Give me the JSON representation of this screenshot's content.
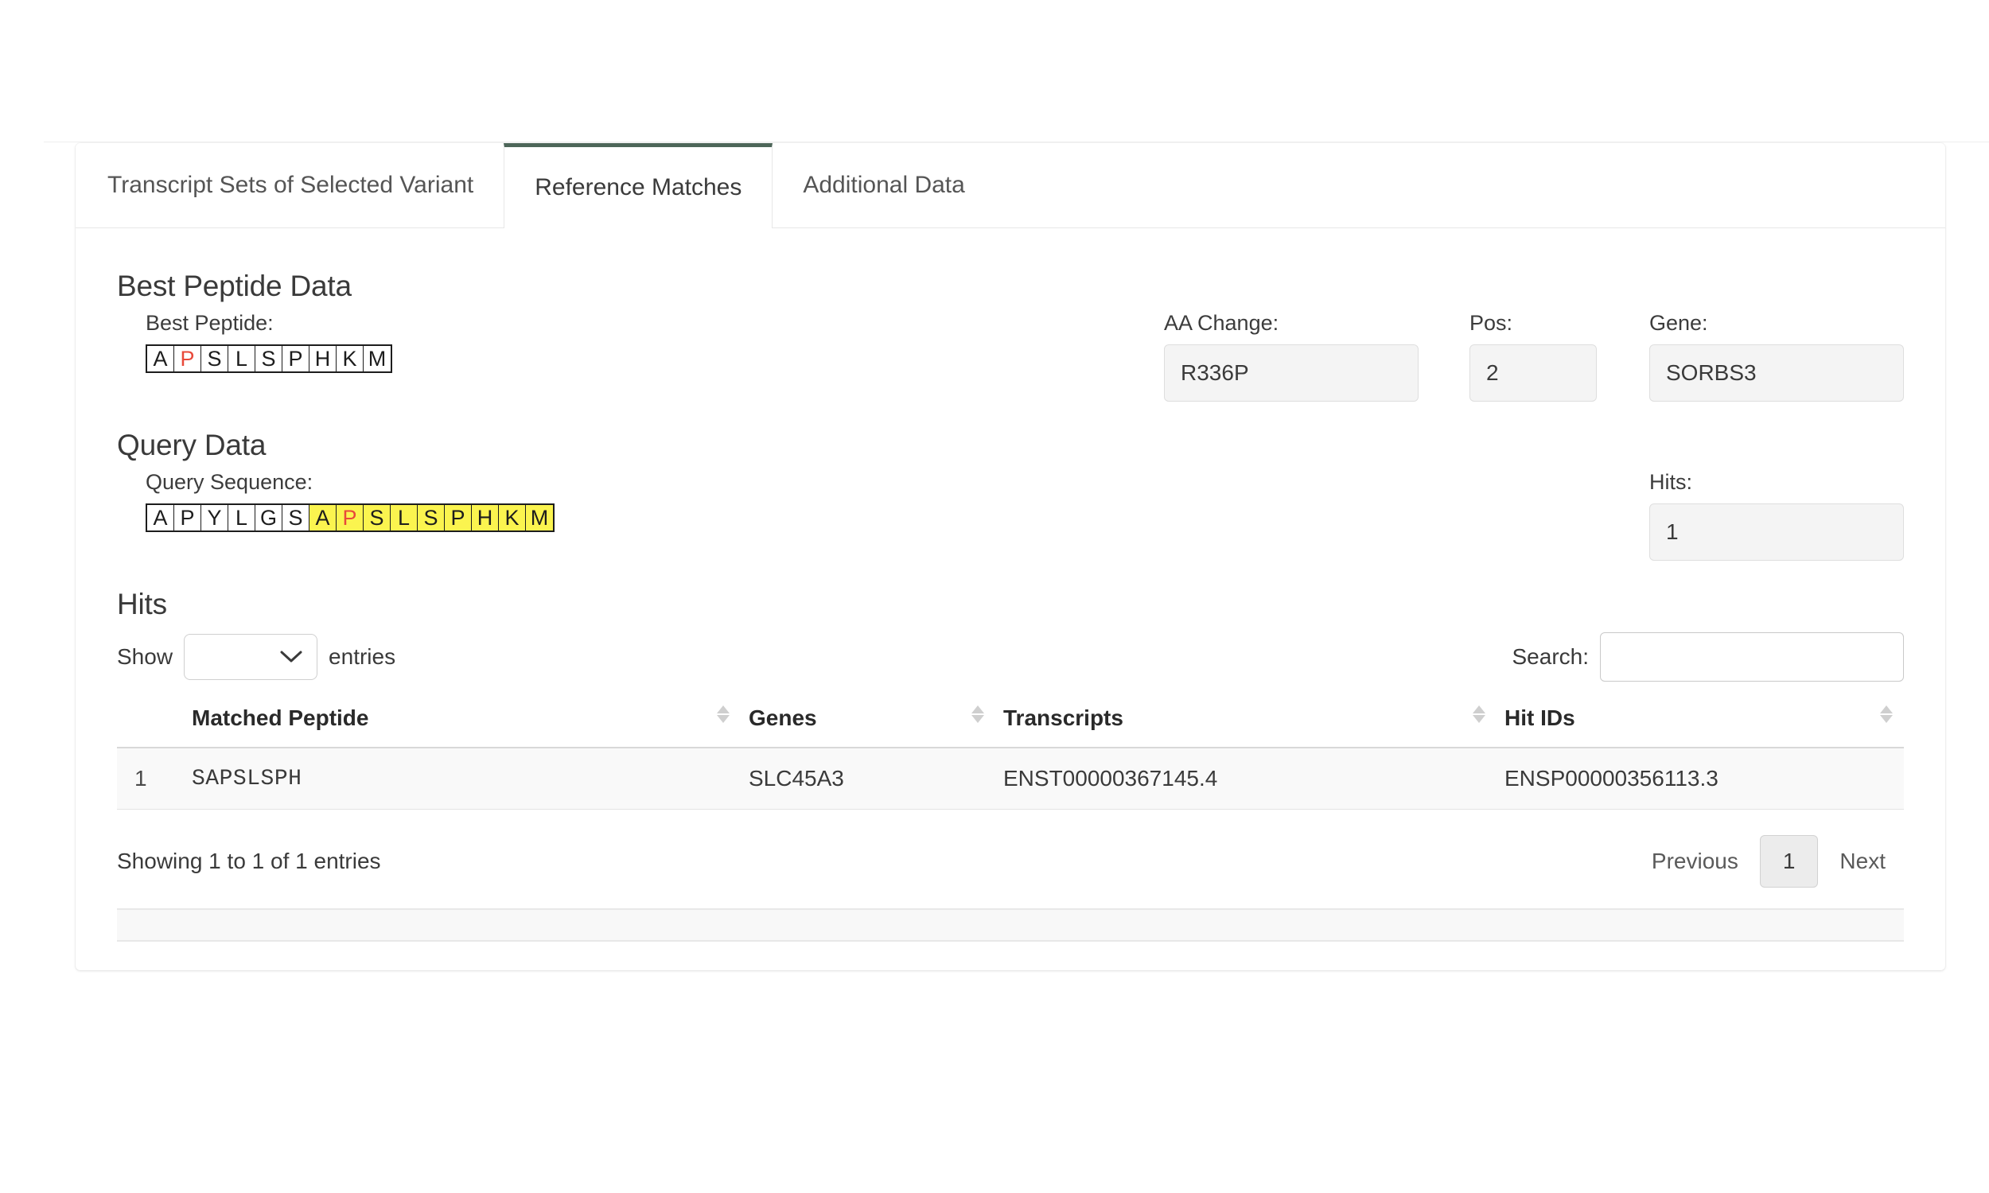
{
  "tabs": [
    {
      "label": "Transcript Sets of Selected Variant",
      "active": false
    },
    {
      "label": "Reference Matches",
      "active": true
    },
    {
      "label": "Additional Data",
      "active": false
    }
  ],
  "best_peptide_section": {
    "title": "Best Peptide Data",
    "peptide_label": "Best Peptide:",
    "peptide_residues": [
      {
        "aa": "A",
        "mutated": false
      },
      {
        "aa": "P",
        "mutated": true
      },
      {
        "aa": "S",
        "mutated": false
      },
      {
        "aa": "L",
        "mutated": false
      },
      {
        "aa": "S",
        "mutated": false
      },
      {
        "aa": "P",
        "mutated": false
      },
      {
        "aa": "H",
        "mutated": false
      },
      {
        "aa": "K",
        "mutated": false
      },
      {
        "aa": "M",
        "mutated": false
      }
    ],
    "aa_change_label": "AA Change:",
    "aa_change_value": "R336P",
    "pos_label": "Pos:",
    "pos_value": "2",
    "gene_label": "Gene:",
    "gene_value": "SORBS3"
  },
  "query_section": {
    "title": "Query Data",
    "sequence_label": "Query Sequence:",
    "sequence_residues": [
      {
        "aa": "A",
        "highlight": false,
        "mutated": false
      },
      {
        "aa": "P",
        "highlight": false,
        "mutated": false
      },
      {
        "aa": "Y",
        "highlight": false,
        "mutated": false
      },
      {
        "aa": "L",
        "highlight": false,
        "mutated": false
      },
      {
        "aa": "G",
        "highlight": false,
        "mutated": false
      },
      {
        "aa": "S",
        "highlight": false,
        "mutated": false
      },
      {
        "aa": "A",
        "highlight": true,
        "mutated": false
      },
      {
        "aa": "P",
        "highlight": true,
        "mutated": true
      },
      {
        "aa": "S",
        "highlight": true,
        "mutated": false
      },
      {
        "aa": "L",
        "highlight": true,
        "mutated": false
      },
      {
        "aa": "S",
        "highlight": true,
        "mutated": false
      },
      {
        "aa": "P",
        "highlight": true,
        "mutated": false
      },
      {
        "aa": "H",
        "highlight": true,
        "mutated": false
      },
      {
        "aa": "K",
        "highlight": true,
        "mutated": false
      },
      {
        "aa": "M",
        "highlight": true,
        "mutated": false
      }
    ],
    "hits_label": "Hits:",
    "hits_value": "1"
  },
  "hits_section": {
    "title": "Hits",
    "show_label": "Show",
    "entries_label": "entries",
    "page_length_selected": "",
    "page_length_options": [
      "",
      "10",
      "25",
      "50",
      "100"
    ],
    "search_label": "Search:",
    "search_value": "",
    "search_placeholder": "",
    "columns": [
      {
        "label": "",
        "sortable": false
      },
      {
        "label": "Matched Peptide",
        "sortable": true
      },
      {
        "label": "Genes",
        "sortable": true
      },
      {
        "label": "Transcripts",
        "sortable": true
      },
      {
        "label": "Hit IDs",
        "sortable": true
      }
    ],
    "rows": [
      {
        "index": "1",
        "matched_peptide": "SAPSLSPH",
        "genes": "SLC45A3",
        "transcripts": "ENST00000367145.4",
        "hit_ids": "ENSP00000356113.3"
      }
    ],
    "info_text": "Showing 1 to 1 of 1 entries",
    "previous_label": "Previous",
    "current_page_label": "1",
    "next_label": "Next"
  },
  "colors": {
    "active_tab_accent": "#4d6659",
    "mutation_red": "#e8493a",
    "highlight_yellow": "#fbf44f",
    "row_background": "#f9f9f9",
    "input_background": "#f4f4f4"
  }
}
